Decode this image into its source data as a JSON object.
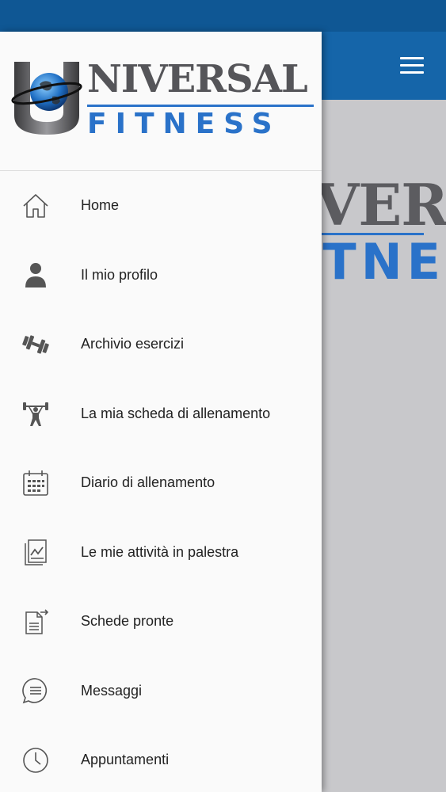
{
  "app": {
    "logo_word_top": "NIVERSAL",
    "logo_word_bottom": "FITNESS",
    "brand_color": "#1565a9",
    "accent_color": "#2a72c9"
  },
  "appbar": {
    "menu_icon": "hamburger-icon"
  },
  "menu": {
    "items": [
      {
        "label": "Home",
        "icon": "home-icon"
      },
      {
        "label": "Il mio profilo",
        "icon": "person-icon"
      },
      {
        "label": "Archivio esercizi",
        "icon": "dumbbell-icon"
      },
      {
        "label": "La mia scheda di allenamento",
        "icon": "weightlifter-icon"
      },
      {
        "label": "Diario di allenamento",
        "icon": "calendar-icon"
      },
      {
        "label": "Le mie attività in palestra",
        "icon": "activity-report-icon"
      },
      {
        "label": "Schede pronte",
        "icon": "document-transfer-icon"
      },
      {
        "label": "Messaggi",
        "icon": "message-icon"
      },
      {
        "label": "Appuntamenti",
        "icon": "clock-icon"
      }
    ]
  }
}
